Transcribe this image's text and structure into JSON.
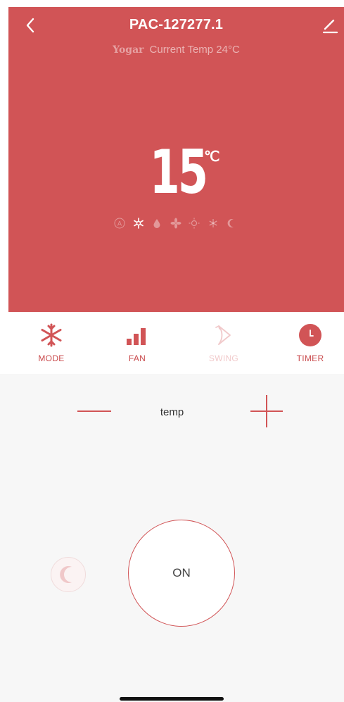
{
  "header": {
    "title": "PAC-127277.1",
    "brand": "Yogar",
    "current_temp_text": "Current Temp 24°C",
    "back_icon": "chevron-left-icon",
    "edit_icon": "pencil-icon"
  },
  "display": {
    "set_temp": "15",
    "unit": "℃",
    "modes": [
      {
        "name": "auto-mode-icon",
        "active": false
      },
      {
        "name": "cool-mode-icon",
        "active": true
      },
      {
        "name": "dry-mode-icon",
        "active": false
      },
      {
        "name": "fan-mode-icon",
        "active": false
      },
      {
        "name": "heat-mode-icon",
        "active": false
      },
      {
        "name": "snow-mode-icon",
        "active": false
      },
      {
        "name": "sleep-mode-icon",
        "active": false
      }
    ]
  },
  "tabs": [
    {
      "label": "MODE",
      "icon": "snowflake-icon",
      "enabled": true
    },
    {
      "label": "FAN",
      "icon": "fan-speed-bars-icon",
      "enabled": true
    },
    {
      "label": "SWING",
      "icon": "swing-icon",
      "enabled": false
    },
    {
      "label": "TIMER",
      "icon": "clock-icon",
      "enabled": true
    }
  ],
  "controls": {
    "temp_label": "temp",
    "power_label": "ON",
    "sleep_icon": "moon-icon"
  },
  "colors": {
    "accent": "#d15456",
    "panel_bg": "#f7f7f7"
  }
}
